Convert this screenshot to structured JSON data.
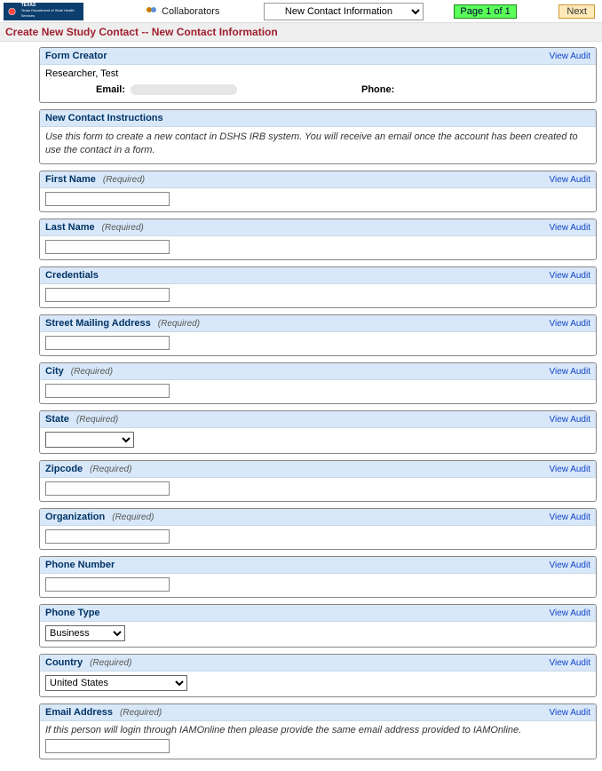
{
  "topbar": {
    "logo_line1": "TEXAS",
    "logo_line2": "Texas Department of State Health Services",
    "collaborators": "Collaborators",
    "section_selected": "New Contact Information",
    "page_indicator": "Page 1 of 1",
    "next": "Next"
  },
  "page_title": "Create New Study Contact -- New Contact Information",
  "view_audit": "View Audit",
  "sections": {
    "form_creator": {
      "title": "Form Creator",
      "name": "Researcher, Test",
      "email_label": "Email:",
      "phone_label": "Phone:"
    },
    "instructions": {
      "title": "New Contact Instructions",
      "text": "Use this form to create a new contact in DSHS IRB system. You will receive an email once the account has been created to use the contact in a form."
    },
    "first_name": {
      "title": "First Name",
      "required": "(Required)",
      "value": ""
    },
    "last_name": {
      "title": "Last Name",
      "required": "(Required)",
      "value": ""
    },
    "credentials": {
      "title": "Credentials",
      "value": ""
    },
    "street": {
      "title": "Street Mailing Address",
      "required": "(Required)",
      "value": ""
    },
    "city": {
      "title": "City",
      "required": "(Required)",
      "value": ""
    },
    "state": {
      "title": "State",
      "required": "(Required)",
      "value": ""
    },
    "zipcode": {
      "title": "Zipcode",
      "required": "(Required)",
      "value": ""
    },
    "organization": {
      "title": "Organization",
      "required": "(Required)",
      "value": ""
    },
    "phone_number": {
      "title": "Phone Number",
      "value": ""
    },
    "phone_type": {
      "title": "Phone Type",
      "value": "Business"
    },
    "country": {
      "title": "Country",
      "required": "(Required)",
      "value": "United States"
    },
    "email": {
      "title": "Email Address",
      "required": "(Required)",
      "note": "If this person will login through IAMOnline then please provide the same email address provided to IAMOnline.",
      "value": ""
    }
  }
}
